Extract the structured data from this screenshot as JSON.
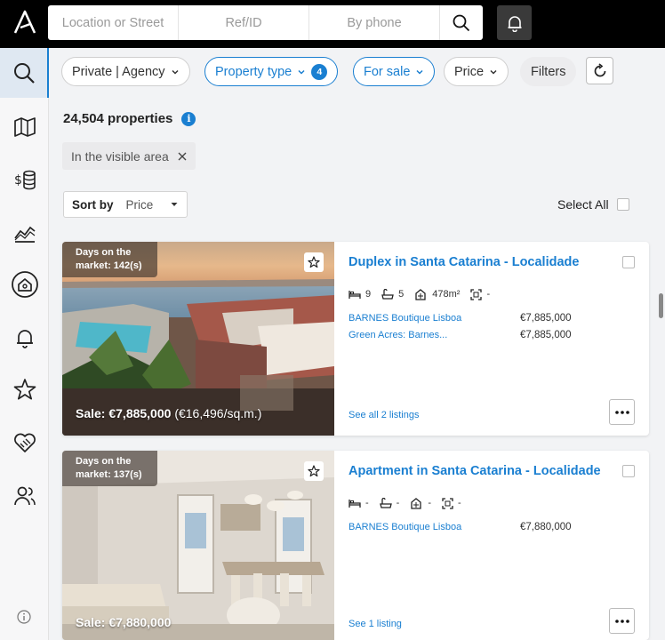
{
  "search": {
    "location_placeholder": "Location or Street",
    "ref_placeholder": "Ref/ID",
    "phone_placeholder": "By phone"
  },
  "filters": {
    "agency": "Private | Agency",
    "property_type": "Property type",
    "property_type_count": "4",
    "for_sale": "For sale",
    "price": "Price",
    "more_filters": "Filters"
  },
  "results": {
    "count": "24,504 properties",
    "area_chip": "In the visible area",
    "sort_label": "Sort by",
    "sort_value": "Price",
    "select_all": "Select All"
  },
  "listings": [
    {
      "days": "Days on the market: 142(s)",
      "title": "Duplex in Santa Catarina - Localidade",
      "beds": "9",
      "baths": "5",
      "area": "478m²",
      "plot": "-",
      "sale": "Sale: €7,885,000",
      "sqm": "(€16,496/sq.m.)",
      "sources": [
        {
          "agency": "BARNES Boutique Lisboa",
          "price": "€7,885,000"
        },
        {
          "agency": "Green Acres: Barnes...",
          "price": "€7,885,000"
        }
      ],
      "see_all": "See all 2 listings"
    },
    {
      "days": "Days on the market: 137(s)",
      "title": "Apartment in Santa Catarina - Localidade",
      "beds": "-",
      "baths": "-",
      "area": "-",
      "plot": "-",
      "sale": "Sale: €7,880,000",
      "sqm": "",
      "sources": [
        {
          "agency": "BARNES Boutique Lisboa",
          "price": "€7,880,000"
        }
      ],
      "see_all": "See 1 listing"
    }
  ],
  "colors": {
    "accent": "#1a7fd1",
    "topbar": "#000000"
  },
  "icons": [
    "logo-icon",
    "search-icon",
    "bell-icon",
    "map-icon",
    "money-icon",
    "chart-icon",
    "home-icon",
    "star-icon",
    "handshake-icon",
    "users-icon",
    "info-icon",
    "refresh-icon",
    "more-icon",
    "bed-icon",
    "bath-icon",
    "area-icon",
    "plot-icon"
  ]
}
